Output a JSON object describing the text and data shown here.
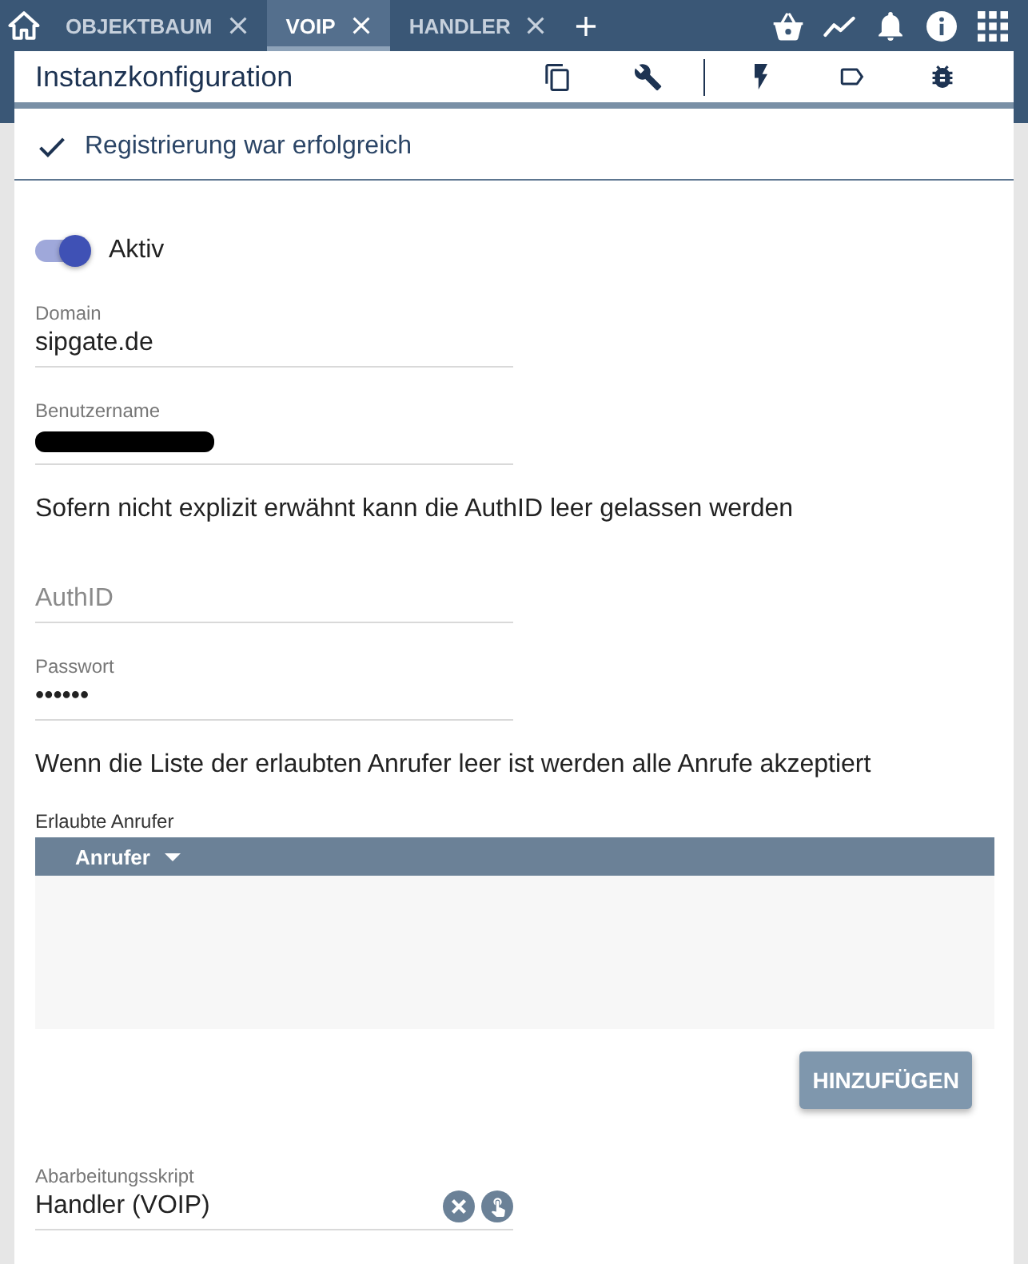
{
  "tab_bar": {
    "tabs": [
      {
        "label": "OBJEKTBAUM",
        "selected": false
      },
      {
        "label": "VOIP",
        "selected": true
      },
      {
        "label": "HANDLER",
        "selected": false
      }
    ]
  },
  "panel": {
    "title": "Instanzkonfiguration",
    "status_message": "Registrierung war erfolgreich"
  },
  "form": [
    {
      "kind": "toggle",
      "label": "Aktiv",
      "on": true
    },
    {
      "kind": "field",
      "label": "Domain",
      "value": "sipgate.de"
    },
    {
      "kind": "field",
      "label": "Benutzername",
      "redacted": true
    },
    {
      "kind": "note",
      "text": "Sofern nicht explizit erwähnt kann die AuthID leer gelassen werden"
    },
    {
      "kind": "field",
      "placeholder": "AuthID"
    },
    {
      "kind": "field",
      "label": "Passwort",
      "value": "••••••"
    },
    {
      "kind": "note",
      "text": "Wenn die Liste der erlaubten Anrufer leer ist werden alle Anrufe akzeptiert"
    },
    {
      "kind": "table",
      "label": "Erlaubte Anrufer",
      "columns": [
        "Anrufer"
      ]
    },
    {
      "kind": "button",
      "label": "HINZUFÜGEN"
    },
    {
      "kind": "select",
      "label": "Abarbeitungsskript",
      "value": "Handler (VOIP)"
    }
  ]
}
